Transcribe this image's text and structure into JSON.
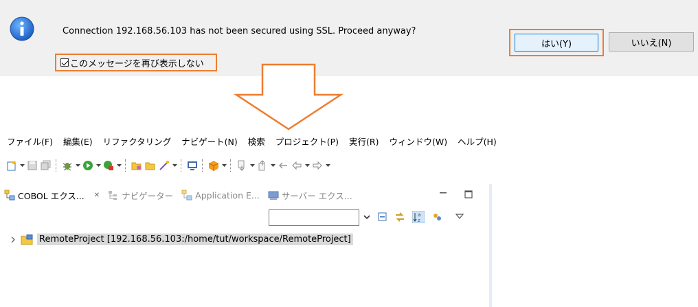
{
  "dialog": {
    "message": "Connection 192.168.56.103 has not been secured using SSL. Proceed anyway?",
    "checkbox_label": "このメッセージを再び表示しない",
    "checkbox_checked": true,
    "yes_label": "はい(Y)",
    "no_label": "いいえ(N)",
    "highlight_color": "#ee7d2e"
  },
  "menubar": {
    "items": [
      "ファイル(F)",
      "編集(E)",
      "リファクタリング",
      "ナビゲート(N)",
      "検索",
      "プロジェクト(P)",
      "実行(R)",
      "ウィンドウ(W)",
      "ヘルプ(H)"
    ]
  },
  "views": {
    "tabs": [
      {
        "label": "COBOL エクス...",
        "active": true,
        "icon": "cobol-explorer-icon"
      },
      {
        "label": "ナビゲーター",
        "active": false,
        "icon": "navigator-icon"
      },
      {
        "label": "Application E...",
        "active": false,
        "icon": "application-explorer-icon"
      },
      {
        "label": "サーバー エクス...",
        "active": false,
        "icon": "server-explorer-icon"
      }
    ],
    "close_glyph": "✕"
  },
  "tree": {
    "project_label": "RemoteProject [192.168.56.103:/home/tut/workspace/RemoteProject]"
  }
}
